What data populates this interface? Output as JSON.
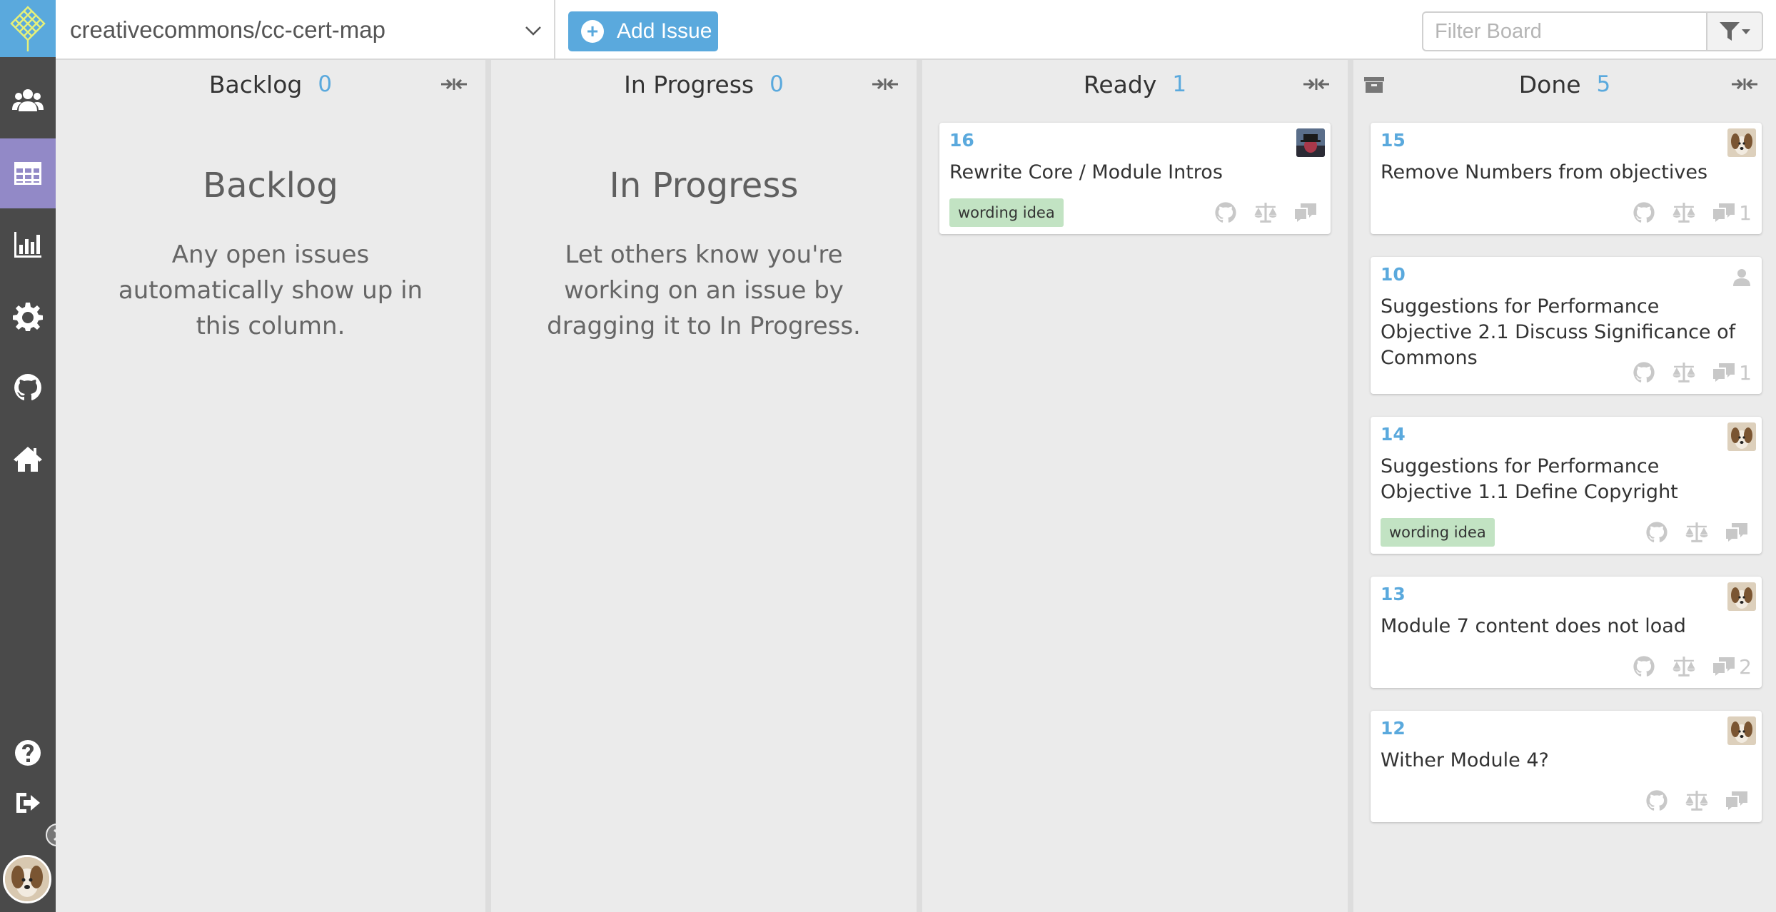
{
  "sidebar": {
    "items": [
      {
        "name": "people",
        "icon": "people-icon"
      },
      {
        "name": "board",
        "icon": "board-icon",
        "active": true
      },
      {
        "name": "stats",
        "icon": "bar-chart-icon"
      },
      {
        "name": "settings",
        "icon": "gear-icon"
      },
      {
        "name": "github",
        "icon": "github-icon"
      },
      {
        "name": "home",
        "icon": "home-icon"
      }
    ],
    "bottom": [
      {
        "name": "help",
        "icon": "question-icon"
      },
      {
        "name": "logout",
        "icon": "sign-out-icon"
      }
    ]
  },
  "topbar": {
    "repo": "creativecommons/cc-cert-map",
    "add_issue_label": "Add Issue",
    "filter_placeholder": "Filter Board"
  },
  "columns": [
    {
      "title": "Backlog",
      "count": "0",
      "empty_title": "Backlog",
      "empty_desc": "Any open issues automatically show up in this column."
    },
    {
      "title": "In Progress",
      "count": "0",
      "empty_title": "In Progress",
      "empty_desc": "Let others know you're working on an issue by dragging it to In Progress."
    },
    {
      "title": "Ready",
      "count": "1",
      "cards": [
        {
          "number": "16",
          "title": "Rewrite Core / Module Intros",
          "label": "wording idea",
          "comments": ""
        }
      ]
    },
    {
      "title": "Done",
      "count": "5",
      "cards": [
        {
          "number": "15",
          "title": "Remove Numbers from objectives",
          "label": "",
          "comments": "1"
        },
        {
          "number": "10",
          "title": "Suggestions for Performance Objective 2.1 Discuss Significance of Commons",
          "label": "",
          "comments": "1"
        },
        {
          "number": "14",
          "title": "Suggestions for Performance Objective 1.1 Define Copyright",
          "label": "wording idea",
          "comments": ""
        },
        {
          "number": "13",
          "title": "Module 7 content does not load",
          "label": "",
          "comments": "2"
        },
        {
          "number": "12",
          "title": "Wither Module 4?",
          "label": "",
          "comments": ""
        }
      ]
    }
  ],
  "colors": {
    "accent": "#5aa9dd",
    "sidebar_bg": "#4a4a4a",
    "sidebar_active": "#9289c7",
    "label_green": "#c2e3c3"
  }
}
